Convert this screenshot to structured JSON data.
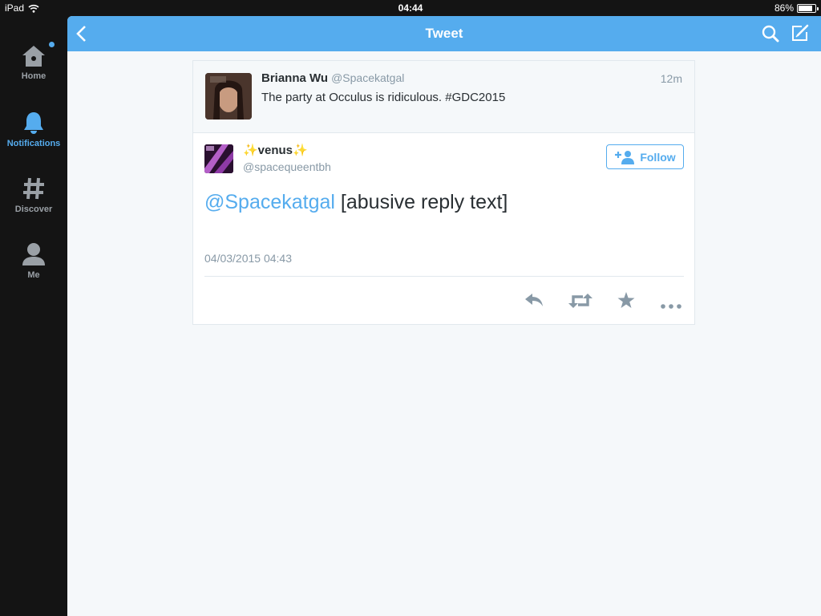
{
  "status": {
    "device": "iPad",
    "time": "04:44",
    "battery": "86%",
    "battery_level": 0.86
  },
  "nav": [
    {
      "label": "Home",
      "icon": "home-icon"
    },
    {
      "label": "Notifications",
      "icon": "bell-icon"
    },
    {
      "label": "Discover",
      "icon": "hashtag-icon"
    },
    {
      "label": "Me",
      "icon": "person-icon"
    }
  ],
  "header": {
    "title": "Tweet"
  },
  "parent_tweet": {
    "name": "Brianna Wu",
    "handle": "@Spacekatgal",
    "time": "12m",
    "text": "The party at Occulus is ridiculous. #GDC2015"
  },
  "reply_tweet": {
    "name": "✨venus✨",
    "handle": "@spacequeentbh",
    "mention": "@Spacekatgal",
    "text": " [abusive reply text]",
    "timestamp": "04/03/2015 04:43",
    "follow_label": "Follow"
  },
  "colors": {
    "accent": "#55acee",
    "sidebar": "#141414",
    "background": "#f5f8fa"
  }
}
